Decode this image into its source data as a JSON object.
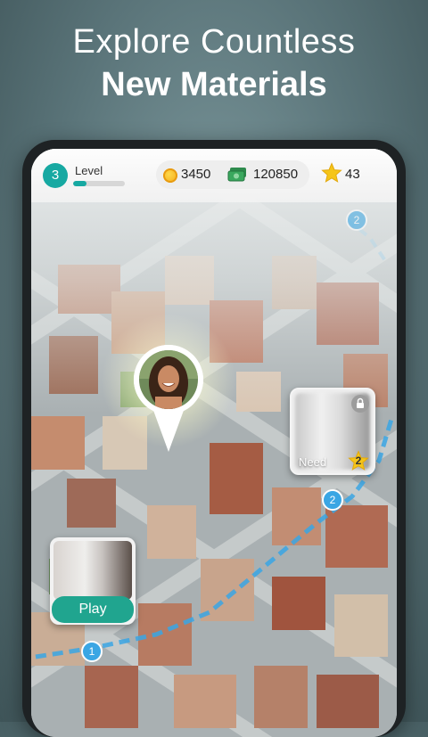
{
  "headline": {
    "line1": "Explore Countless",
    "line2": "New Materials"
  },
  "hud": {
    "level_number": "3",
    "level_label": "Level",
    "level_progress": 0.25,
    "coins": "3450",
    "cash": "120850",
    "stars": "43"
  },
  "locked_level": {
    "need_label": "Need",
    "need_stars": "2"
  },
  "current_level": {
    "play_label": "Play"
  },
  "path_nodes": [
    "1",
    "2",
    "2"
  ],
  "colors": {
    "accent": "#17a9a2",
    "play": "#20a58f",
    "path": "#3aa6e4",
    "star": "#f5c518"
  }
}
